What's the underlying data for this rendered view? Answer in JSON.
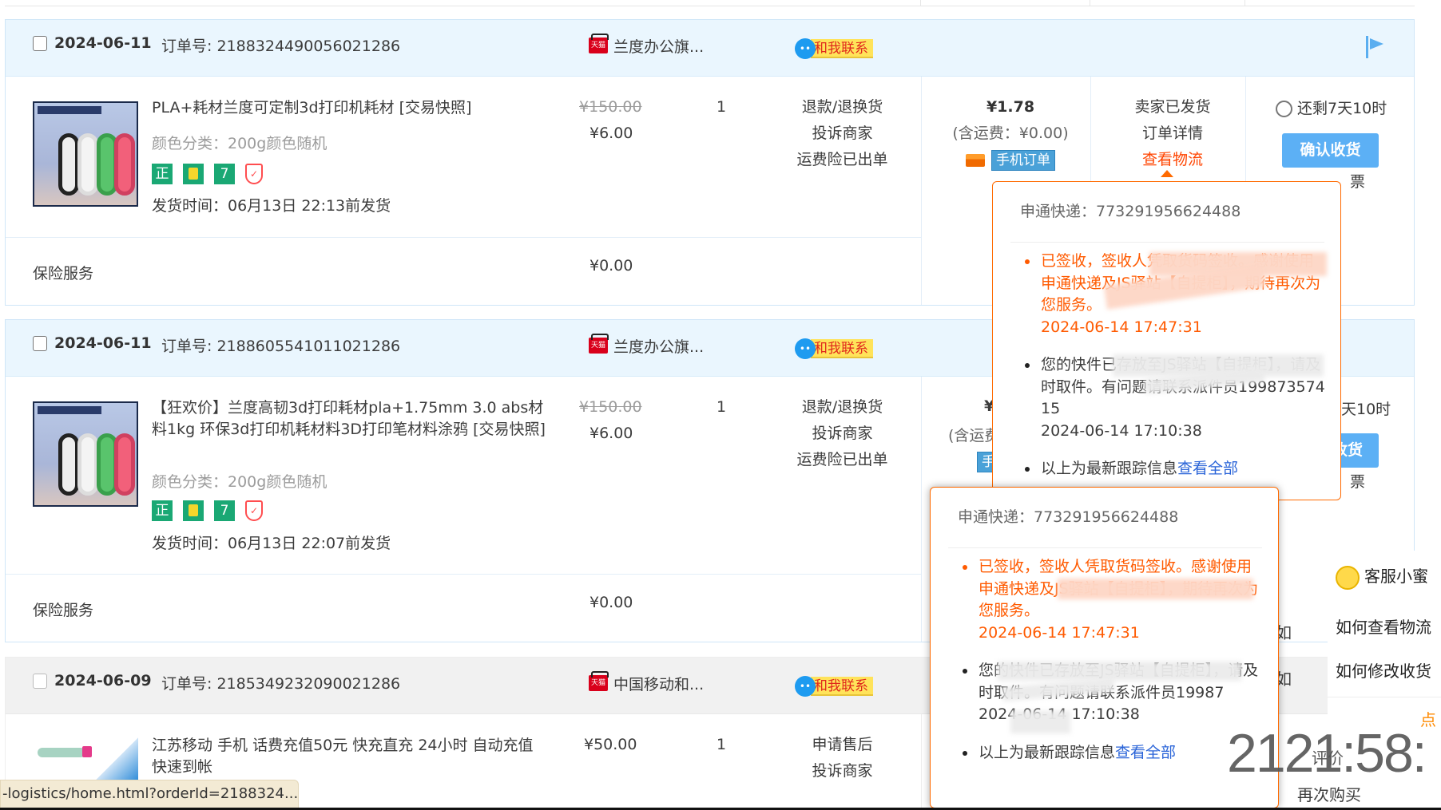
{
  "colors": {
    "accent": "#ff4400",
    "header_blue": "#eaf6fe",
    "link": "#2a64d8",
    "button": "#5cb0f5"
  },
  "orders": [
    {
      "date": "2024-06-11",
      "order_no": "订单号: 2188324490056021286",
      "shop": "兰度办公旗...",
      "contact": "和我联系",
      "platform_badge": "天猫",
      "item": {
        "title": "PLA+耗材兰度可定制3d打印机耗材 [交易快照]",
        "sku": "颜色分类：200g颜色随机",
        "tags": [
          "正",
          "7"
        ],
        "ship_time": "发货时间：06月13日 22:13前发货",
        "original_price": "¥150.00",
        "price": "¥6.00",
        "qty": "1",
        "actions": [
          "退款/退换货",
          "投诉商家",
          "运费险已出单"
        ]
      },
      "total": "¥1.78",
      "shipping": "(含运费：¥0.00)",
      "mobile_badge": "手机订单",
      "status": [
        "卖家已发货",
        "订单详情",
        "查看物流"
      ],
      "countdown": "还剩7天10时",
      "confirm": "确认收货",
      "invoice_fragment": "票",
      "insurance": {
        "label": "保险服务",
        "value": "¥0.00"
      }
    },
    {
      "date": "2024-06-11",
      "order_no": "订单号: 2188605541011021286",
      "shop": "兰度办公旗...",
      "contact": "和我联系",
      "platform_badge": "天猫",
      "item": {
        "title": "【狂欢价】兰度高韧3d打印耗材pla+1.75mm 3.0 abs材料1kg 环保3d打印机耗材料3D打印笔材料涂鸦 [交易快照]",
        "sku": "颜色分类：200g颜色随机",
        "tags": [
          "正",
          "7"
        ],
        "ship_time": "发货时间：06月13日 22:07前发货",
        "original_price": "¥150.00",
        "price": "¥6.00",
        "qty": "1",
        "actions": [
          "退款/退换货",
          "投诉商家",
          "运费险已出单"
        ]
      },
      "total_fragment": "¥",
      "shipping_fragment": "(含运费",
      "mobile_fragment": "手",
      "countdown_fragment": "天10时",
      "confirm_fragment": "收货",
      "invoice_fragment": "票",
      "insurance": {
        "label": "保险服务",
        "value": "¥0.00"
      }
    },
    {
      "date": "2024-06-09",
      "order_no": "订单号: 2185349232090021286",
      "shop": "中国移动和...",
      "contact": "和我联系",
      "platform_badge": "天猫",
      "item": {
        "title": "江苏移动 手机 话费充值50元 快充直充 24小时 自动充值 快速到帐",
        "price": "¥50.00",
        "qty": "1",
        "actions": [
          "申请售后",
          "投诉商家"
        ]
      }
    }
  ],
  "popups": [
    {
      "header": "申通快递：773291956624488",
      "events": [
        {
          "text": "已签收，签收人凭取货码签收。感谢使用申通快递及JS驿站【自提柜】，期待再次为您服务。",
          "time": "2024-06-14 17:47:31"
        },
        {
          "text": "您的快件已存放至JS驿站【自提柜】，请及时取件。有问题请联系派件员19987357415",
          "time": "2024-06-14 17:10:38"
        }
      ],
      "footer": "以上为最新跟踪信息",
      "footer_link": "查看全部"
    },
    {
      "header": "申通快递：773291956624488",
      "events": [
        {
          "text": "已签收，签收人凭取货码签收。感谢使用申通快递及JS驿站【自提柜】，期待再次为您服务。",
          "time": "2024-06-14 17:47:31"
        },
        {
          "text": "您的快件已存放至JS驿站【自提柜】，请及时取件。有问题请联系派件员19987",
          "time": "2024-06-14 17:10:38"
        }
      ],
      "footer": "以上为最新跟踪信息",
      "footer_link": "查看全部"
    }
  ],
  "behind": {
    "frag1": "如",
    "frag2": "如",
    "rate": "评价",
    "rebuy": "再次购买"
  },
  "assistant": {
    "title": "客服小蜜",
    "q1": "如何查看物流",
    "q2": "如何修改收货",
    "more": "点"
  },
  "overlay_clock": "2121:58:",
  "status_bar": "-logistics/home.html?orderId=2188324..."
}
